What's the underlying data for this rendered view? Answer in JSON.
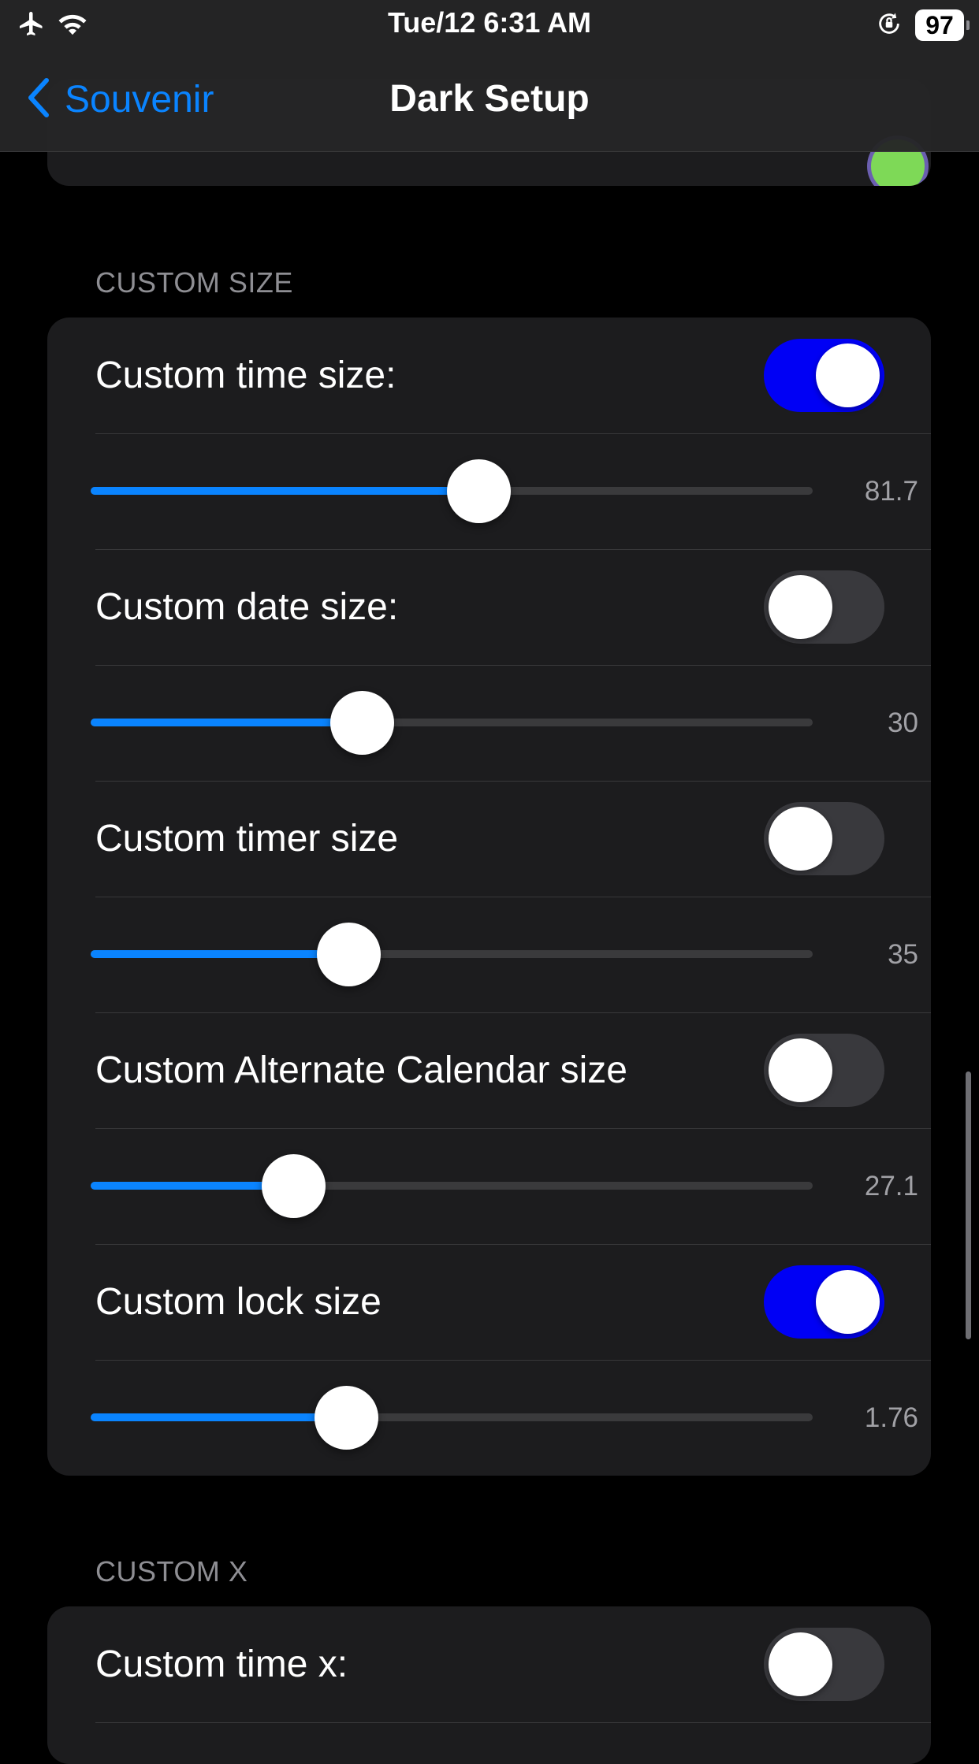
{
  "status_bar": {
    "time": "Tue/12 6:31 AM",
    "battery": "97",
    "icons": [
      "airplane-icon",
      "wifi-icon",
      "orientation-lock-icon",
      "battery-icon"
    ]
  },
  "nav": {
    "back_label": "Souvenir",
    "title": "Dark Setup"
  },
  "colors": {
    "background": "#000000",
    "card": "#1c1c1e",
    "accent": "#0a84ff",
    "switch_on": "#0000f5",
    "switch_off": "#39393d",
    "section_header": "#8e8e93"
  },
  "custom_size": {
    "header": "CUSTOM SIZE",
    "rows": [
      {
        "label": "Custom time size:",
        "on": true,
        "value": "81.7",
        "fraction": 0.537
      },
      {
        "label": "Custom date size:",
        "on": false,
        "value": "30",
        "fraction": 0.376
      },
      {
        "label": "Custom timer size",
        "on": false,
        "value": "35",
        "fraction": 0.357
      },
      {
        "label": "Custom Alternate Calendar size",
        "on": false,
        "value": "27.1",
        "fraction": 0.281
      },
      {
        "label": "Custom lock size",
        "on": true,
        "value": "1.76",
        "fraction": 0.354
      }
    ]
  },
  "custom_x": {
    "header": "CUSTOM X",
    "rows": [
      {
        "label": "Custom time x:",
        "on": false
      }
    ]
  }
}
